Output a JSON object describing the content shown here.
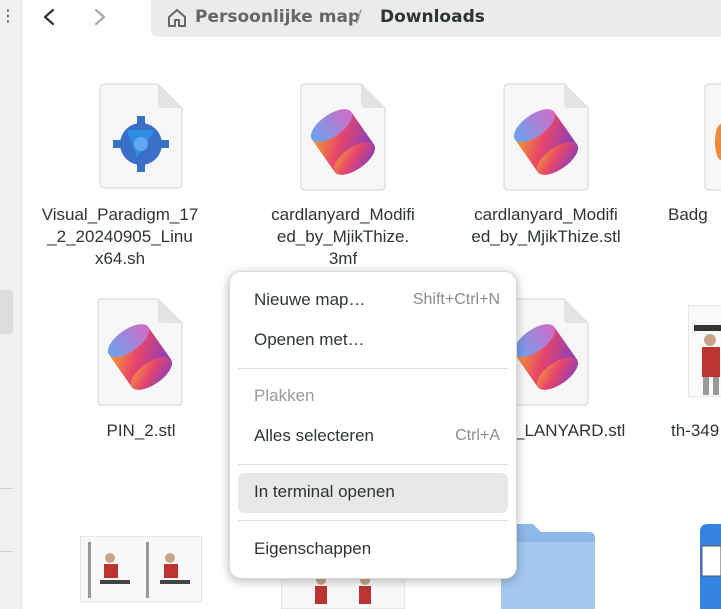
{
  "nav": {
    "back_icon": "go-previous-icon",
    "forward_icon": "go-next-icon"
  },
  "pathbar": {
    "home_label": "Persoonlijke map",
    "separator": "/",
    "current": "Downloads"
  },
  "files": [
    {
      "name": "Visual_Paradigm_17_2_20240905_Linux64.sh",
      "lines": [
        "Visual_Paradigm_17",
        "_2_20240905_Linu",
        "x64.sh"
      ],
      "icon": "script-icon"
    },
    {
      "name": "cardlanyard_Modified_by_MjikThize.3mf",
      "lines": [
        "cardlanyard_Modifi",
        "ed_by_MjikThize.",
        "3mf"
      ],
      "icon": "model-3d-icon"
    },
    {
      "name": "cardlanyard_Modified_by_MjikThize.stl",
      "lines": [
        "cardlanyard_Modifi",
        "ed_by_MjikThize.stl"
      ],
      "icon": "model-3d-icon"
    },
    {
      "name": "Badg",
      "lines": [
        "Badg"
      ],
      "icon": "model-3d-icon"
    },
    {
      "name": "PIN_2.stl",
      "lines": [
        "PIN_2.stl"
      ],
      "icon": "model-3d-icon"
    },
    {
      "name": "_LANYARD.stl",
      "lines": [
        "_LANYARD.stl"
      ],
      "icon": "model-3d-icon"
    },
    {
      "name": "th-349",
      "lines": [
        "th-349"
      ],
      "icon": "image-thumbnail"
    }
  ],
  "context_menu": {
    "items": [
      {
        "label": "Nieuwe map…",
        "shortcut": "Shift+Ctrl+N"
      },
      {
        "label": "Openen met…",
        "shortcut": ""
      },
      {
        "label": "Plakken",
        "shortcut": ""
      },
      {
        "label": "Alles selecteren",
        "shortcut": "Ctrl+A"
      },
      {
        "label": "In terminal openen",
        "shortcut": ""
      },
      {
        "label": "Eigenschappen",
        "shortcut": ""
      }
    ]
  },
  "colors": {
    "accent_blue": "#3584e4",
    "folder_blue": "#8fb8ea",
    "menu_hover": "#e8e8e8"
  }
}
